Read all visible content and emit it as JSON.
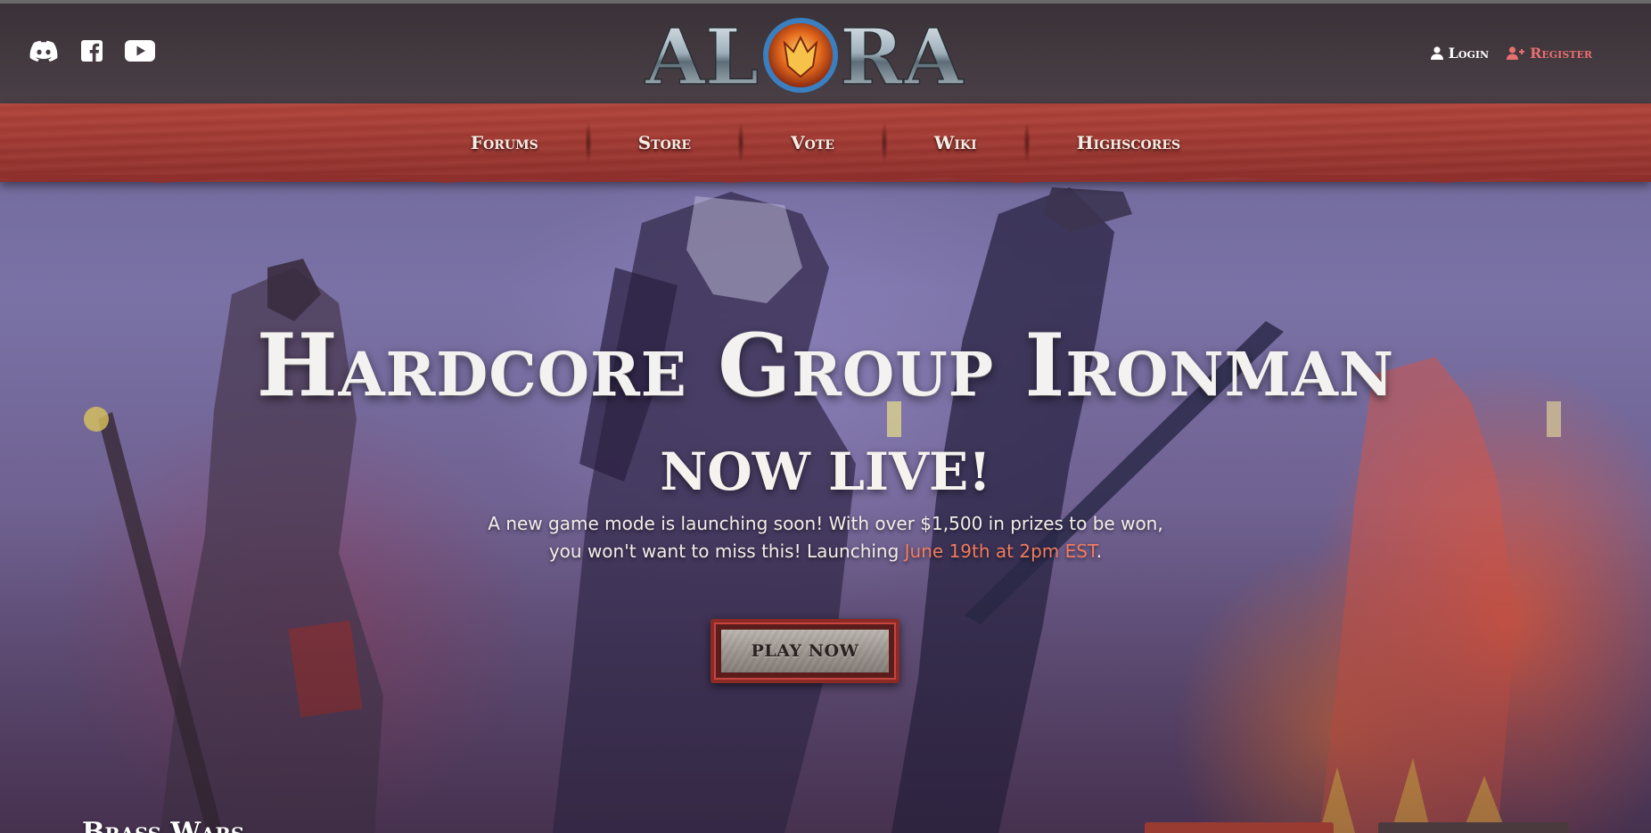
{
  "header": {
    "social": [
      {
        "icon": "discord-icon"
      },
      {
        "icon": "facebook-icon"
      },
      {
        "icon": "youtube-icon"
      }
    ],
    "logo": {
      "text": "ALORA"
    },
    "account": {
      "login_label": "Login",
      "register_label": "Register"
    }
  },
  "nav": {
    "items": [
      {
        "label": "Forums"
      },
      {
        "label": "Store"
      },
      {
        "label": "Vote"
      },
      {
        "label": "Wiki"
      },
      {
        "label": "Highscores"
      }
    ]
  },
  "hero": {
    "title": "Hardcore Group Ironman",
    "subtitle": "NOW LIVE!",
    "description_line1": "A new game mode is launching soon! With over $1,500 in prizes to be won,",
    "description_line2_prefix": "you won't want to miss this! Launching ",
    "description_highlight": "June 19th at 2pm EST",
    "description_suffix": ".",
    "cta_label": "PLAY NOW"
  },
  "bottom": {
    "heading": "Brass Wars"
  },
  "colors": {
    "nav_red": "#a33a33",
    "header_dark": "#3a3238",
    "accent_red": "#e86f6f",
    "highlight_orange": "#f07b5f"
  }
}
